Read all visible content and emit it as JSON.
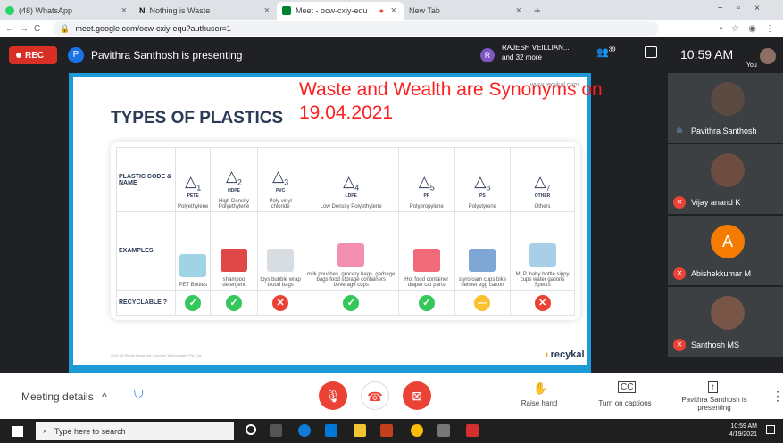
{
  "browser": {
    "tabs": [
      {
        "label": "(48) WhatsApp",
        "color": "#25d366"
      },
      {
        "label": "Nothing is Waste",
        "color": "#111111",
        "glyph": "N"
      },
      {
        "label": "Meet - ocw-cxiy-equ",
        "color": "#00832d"
      },
      {
        "label": "New Tab",
        "color": "#ffffff"
      }
    ],
    "new_tab": "+",
    "url": "meet.google.com/ocw-cxiy-equ?authuser=1"
  },
  "meet": {
    "rec": "REC",
    "presenter_initial": "P",
    "presenting_text": "Pavithra Santhosh is presenting",
    "others_initial": "R",
    "others_text": "RAJESH VEILLIAN... and 32 more",
    "people_count": "39",
    "time": "10:59 AM",
    "you": "You"
  },
  "overlay_text": "Waste and Wealth are Synonyms on 19.04.2021",
  "slide": {
    "title": "TYPES OF PLASTICS",
    "url_mark": "www.recykal.com",
    "logo": "recykal",
    "footer": "2019 All Rights Reserved. Eruptive Technologies Pvt. Ltd.",
    "row_headers": [
      "PLASTIC CODE & NAME",
      "EXAMPLES",
      "RECYCLABLE ?"
    ],
    "columns": [
      {
        "num": "1",
        "code": "PETE",
        "name": "Polyethylene",
        "example": "PET Bottles",
        "recyclable": "yes",
        "thumb": "#9fd3e6"
      },
      {
        "num": "2",
        "code": "HDPE",
        "name": "High Density Polyethylene",
        "example": "shampoo detergent",
        "recyclable": "yes",
        "thumb": "#e04848"
      },
      {
        "num": "3",
        "code": "PVC",
        "name": "Poly vinyl chloride",
        "example": "toys bubble wrap blood bags",
        "recyclable": "no",
        "thumb": "#d8dde2"
      },
      {
        "num": "4",
        "code": "LDPE",
        "name": "Low Density Polyethylene",
        "example": "milk pouches, grocery bags, garbage bags food storage containers beverage cups",
        "recyclable": "yes",
        "thumb": "#f28fb2"
      },
      {
        "num": "5",
        "code": "PP",
        "name": "Polypropylene",
        "example": "Hot food container diaper car parts",
        "recyclable": "yes",
        "thumb": "#f06a7a"
      },
      {
        "num": "6",
        "code": "PS",
        "name": "Polystyrene",
        "example": "styrofoam cups bike helmet egg carton",
        "recyclable": "maybe",
        "thumb": "#7fa7d6"
      },
      {
        "num": "7",
        "code": "OTHER",
        "name": "Others",
        "example": "MLP, baby bottle sippy cups water gallons Spects",
        "recyclable": "no",
        "thumb": "#a9cfe8"
      }
    ]
  },
  "participants": [
    {
      "name": "Pavithra Santhosh",
      "avatar": "",
      "color": "#5a4a42"
    },
    {
      "name": "Vijay anand K",
      "avatar": "",
      "color": "#6d4c41"
    },
    {
      "name": "Abishekkumar M",
      "avatar": "A",
      "color": "#f57c00"
    },
    {
      "name": "Santhosh MS",
      "avatar": "",
      "color": "#795548"
    }
  ],
  "bottom": {
    "meeting_details": "Meeting details",
    "raise_hand": "Raise hand",
    "captions": "Turn on captions",
    "presenting": "Pavithra Santhosh is presenting"
  },
  "taskbar": {
    "search_placeholder": "Type here to search",
    "time": "10:59 AM",
    "date": "4/19/2021"
  },
  "colors": {
    "accent": "#1a73e8",
    "danger": "#ea4335",
    "ok": "#34c759",
    "warn": "#fbc02d"
  }
}
